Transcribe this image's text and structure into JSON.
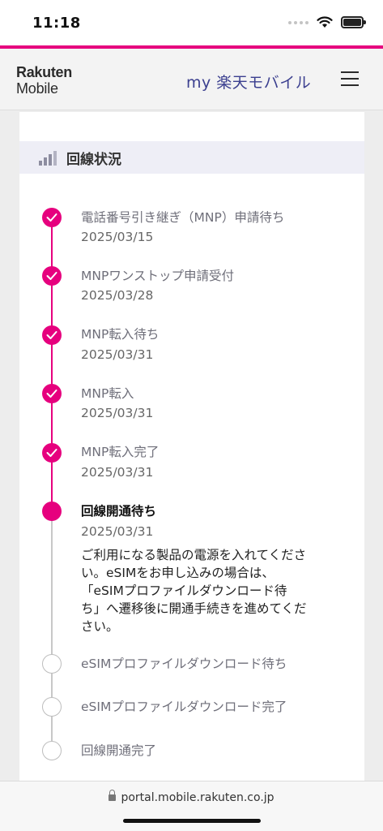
{
  "status_bar": {
    "time": "11:18"
  },
  "header": {
    "logo_top": "Rakuten",
    "logo_bottom": "Mobile",
    "title": "my 楽天モバイル"
  },
  "section": {
    "title": "回線状況"
  },
  "steps": [
    {
      "label": "電話番号引き継ぎ（MNP）申請待ち",
      "date": "2025/03/15",
      "state": "done"
    },
    {
      "label": "MNPワンストップ申請受付",
      "date": "2025/03/28",
      "state": "done"
    },
    {
      "label": "MNP転入待ち",
      "date": "2025/03/31",
      "state": "done"
    },
    {
      "label": "MNP転入",
      "date": "2025/03/31",
      "state": "done"
    },
    {
      "label": "MNP転入完了",
      "date": "2025/03/31",
      "state": "done"
    },
    {
      "label": "回線開通待ち",
      "date": "2025/03/31",
      "state": "current",
      "description": [
        "ご利用になる製品の電源を入れてくださ",
        "い。eSIMをお申し込みの場合は、",
        "「eSIMプロファイルダウンロード待",
        "ち」へ遷移後に開通手続きを進めてくだ",
        "さい。"
      ]
    },
    {
      "label": "eSIMプロファイルダウンロード待ち",
      "state": "pending"
    },
    {
      "label": "eSIMプロファイルダウンロード完了",
      "state": "pending"
    },
    {
      "label": "回線開通完了",
      "state": "pending"
    }
  ],
  "browser": {
    "url": "portal.mobile.rakuten.co.jp"
  },
  "colors": {
    "accent": "#e6007e",
    "title_blue": "#3b3f8f",
    "pending_line": "#c8c8c8"
  }
}
